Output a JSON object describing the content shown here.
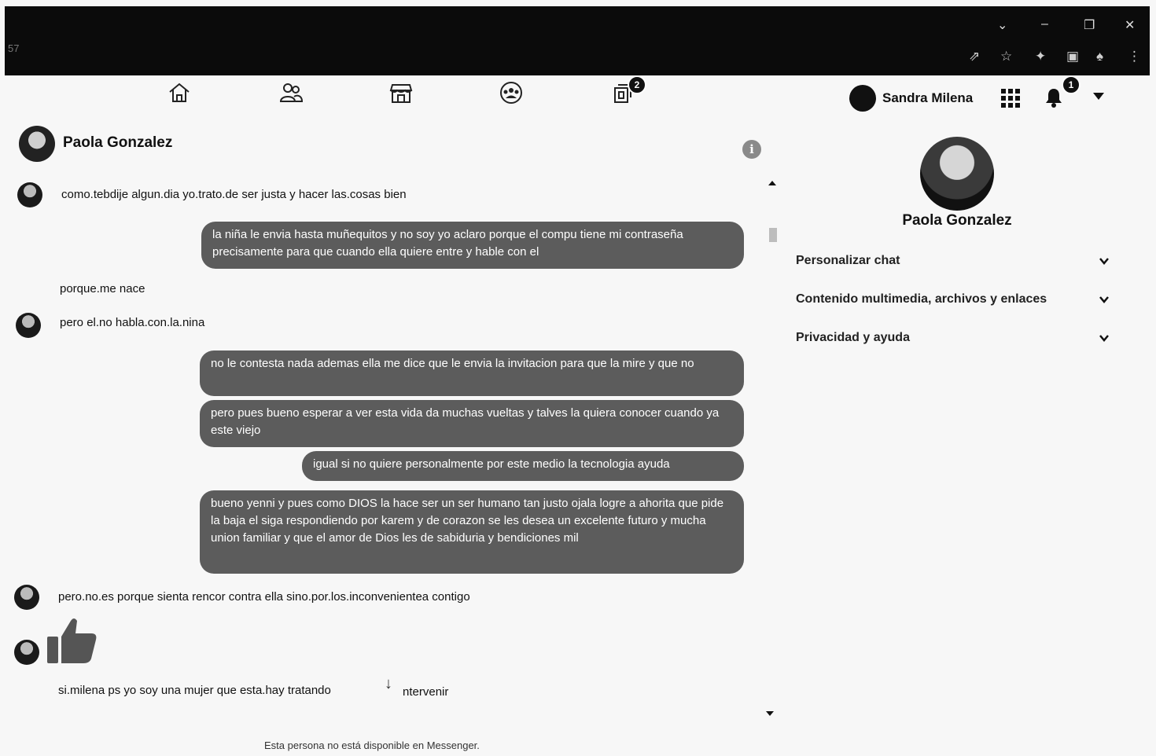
{
  "browser": {
    "tab_number": "57",
    "window_controls": [
      "chevron-down-icon",
      "minimize-icon",
      "restore-icon",
      "close-icon"
    ],
    "toolbar_icons": [
      "share-icon",
      "star-icon",
      "extensions-icon",
      "profile-icon",
      "bell-icon",
      "menu-icon"
    ]
  },
  "topnav": {
    "icons": [
      "home-icon",
      "friends-icon",
      "marketplace-icon",
      "groups-icon",
      "gaming-icon"
    ],
    "gaming_badge": "2",
    "user_name": "Sandra Milena",
    "notifications_badge": "1"
  },
  "conversation": {
    "name": "Paola Gonzalez",
    "messages": [
      {
        "side": "in",
        "text": "como.tebdije algun.dia yo.trato.de ser justa y hacer las.cosas bien"
      },
      {
        "side": "out",
        "text": "la niña le envia hasta muñequitos y no soy yo aclaro porque el compu tiene mi contraseña precisamente para que cuando ella quiere entre y hable con el"
      },
      {
        "side": "in",
        "text": "porque.me nace"
      },
      {
        "side": "in",
        "text": "pero el.no habla.con.la.nina"
      },
      {
        "side": "out",
        "text": "no le contesta nada ademas ella me dice que le envia la invitacion para que la mire y que no"
      },
      {
        "side": "out",
        "text": "pero pues bueno esperar a ver esta vida da muchas vueltas y talves la quiera conocer cuando ya este viejo"
      },
      {
        "side": "out",
        "text": "igual si no quiere personalmente por este medio la tecnologia ayuda"
      },
      {
        "side": "out",
        "text": "bueno yenni y pues como DIOS la hace ser un ser humano tan justo ojala logre a ahorita que pide la baja el siga respondiendo por karem y de corazon se les desea un excelente futuro y mucha union familiar y que el amor de Dios les de sabiduria y bendiciones mil"
      },
      {
        "side": "in",
        "text": "pero.no.es porque sienta rencor contra ella sino.por.los.inconvenientea contigo"
      },
      {
        "side": "in",
        "text": "si.milena ps yo soy una mujer que esta.hay tratando"
      },
      {
        "side": "in",
        "text": "ntervenir"
      }
    ],
    "footer": "Esta persona no está disponible en Messenger."
  },
  "panel": {
    "name": "Paola Gonzalez",
    "rows": [
      "Personalizar chat",
      "Contenido multimedia, archivos y enlaces",
      "Privacidad y ayuda"
    ]
  }
}
